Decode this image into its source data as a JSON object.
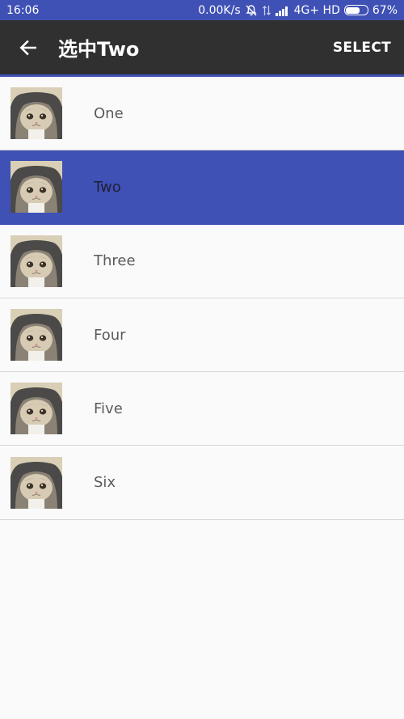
{
  "status_bar": {
    "time": "16:06",
    "net_speed": "0.00K/s",
    "network": "4G+ HD",
    "battery": "67%",
    "battery_level": 0.67
  },
  "toolbar": {
    "back_icon": "arrow-left-icon",
    "title": "选中Two",
    "select_label": "SELECT"
  },
  "list": {
    "selected_index": 1,
    "accent_color": "#3f51b5",
    "items": [
      {
        "label": "One"
      },
      {
        "label": "Two"
      },
      {
        "label": "Three"
      },
      {
        "label": "Four"
      },
      {
        "label": "Five"
      },
      {
        "label": "Six"
      }
    ]
  }
}
